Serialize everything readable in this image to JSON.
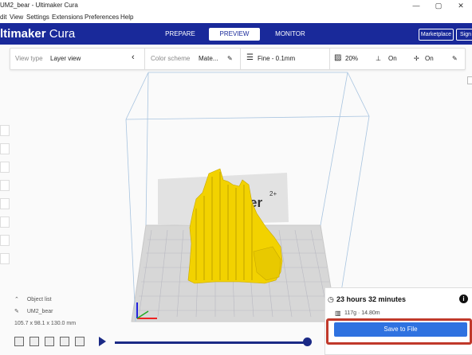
{
  "window": {
    "title": "UM2_bear - Ultimaker Cura",
    "controls": {
      "minimize": "—",
      "maximize": "▢",
      "close": "✕"
    }
  },
  "menubar": {
    "items": [
      "dit",
      "View",
      "Settings",
      "Extensions",
      "Preferences",
      "Help"
    ]
  },
  "header": {
    "brand_bold": "ltimaker",
    "brand_light": "Cura",
    "tabs": [
      {
        "label": "PREPARE",
        "active": false
      },
      {
        "label": "PREVIEW",
        "active": true
      },
      {
        "label": "MONITOR",
        "active": false
      }
    ],
    "marketplace_label": "Marketplace",
    "signin_label": "Sign",
    "bg_color": "#19299a"
  },
  "view_panel": {
    "view_type_label": "View type",
    "view_type_value": "Layer view",
    "color_scheme_label": "Color scheme",
    "color_scheme_value": "Mate...",
    "profile": "Fine - 0.1mm",
    "infill": "20%",
    "support": "On",
    "adhesion": "On"
  },
  "build_plate": {
    "logo_text": "er",
    "logo_suffix": "2+"
  },
  "object_list": {
    "header": "Object list",
    "object_name": "UM2_bear",
    "dimensions": "105.7 x 98.1 x 130.0 mm"
  },
  "print_panel": {
    "time": "23 hours 32 minutes",
    "info_icon": "i",
    "material": "117g · 14.80m",
    "save_label": "Save to File",
    "save_color": "#2f72e0",
    "highlight_color": "#c0392b"
  },
  "playback": {
    "progress": 1.0
  },
  "model_color": "#f2d200"
}
